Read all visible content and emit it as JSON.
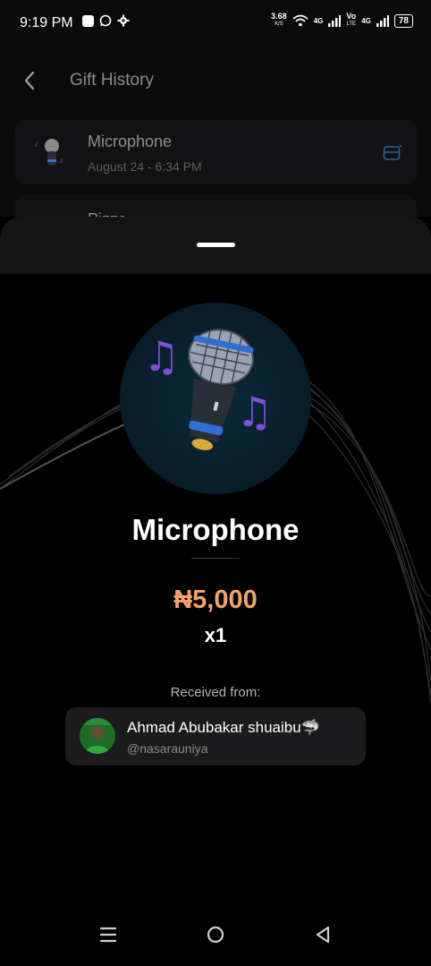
{
  "status_bar": {
    "time": "9:19 PM",
    "speed_value": "3.68",
    "speed_unit": "K/S",
    "net1": "4G",
    "volte_top": "Vo",
    "volte_bottom": "LTE",
    "net2": "4G",
    "battery": "78"
  },
  "header": {
    "title": "Gift History"
  },
  "history": [
    {
      "name": "Microphone",
      "date": "August 24 - 6:34 PM"
    },
    {
      "name": "Pizza"
    }
  ],
  "gift": {
    "name": "Microphone",
    "price": "₦5,000",
    "quantity": "x1"
  },
  "sender": {
    "label": "Received from:",
    "name": "Ahmad Abubakar shuaibu🦈",
    "handle": "@nasarauniya"
  },
  "colors": {
    "price": "#f2a36d",
    "accent_blue": "#2f6fd6",
    "music_note": "#7b4fd9"
  }
}
